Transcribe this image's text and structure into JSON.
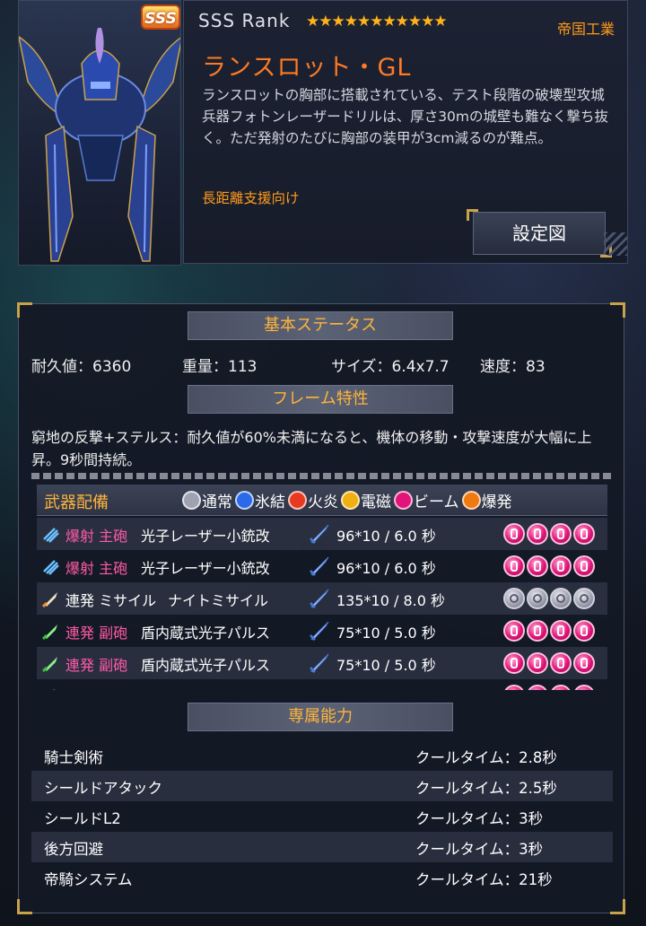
{
  "header": {
    "rarity_badge": "SSS",
    "rank_label": "SSS  Rank",
    "stars": "★★★★★★★★★★★",
    "manufacturer": "帝国工業",
    "mech_name": "ランスロット・GL",
    "description": "ランスロットの胸部に搭載されている、テスト段階の破壊型攻城兵器フォトンレーザードリルは、厚さ30mの城壁も難なく撃ち抜く。ただ発射のたびに胸部の装甲が3cm減るのが難点。",
    "role": "長距離支援向け",
    "setting_button": "設定図"
  },
  "basic_status": {
    "title": "基本ステータス",
    "durability": "耐久値：6360",
    "weight": "重量：113",
    "size": "サイズ：6.4x7.7",
    "speed": "速度：83"
  },
  "frame": {
    "title": "フレーム特性",
    "text": "窮地の反撃+ステルス：耐久値が60%未満になると、機体の移動・攻撃速度が大幅に上昇。9秒間持続。"
  },
  "weapons": {
    "title": "武器配備",
    "legend": [
      {
        "label": "通常",
        "icon": "normal-icon",
        "color": "#b8bac8"
      },
      {
        "label": "氷結",
        "icon": "ice-icon",
        "color": "#2a6ae8"
      },
      {
        "label": "火炎",
        "icon": "fire-icon",
        "color": "#e83a20"
      },
      {
        "label": "電磁",
        "icon": "electric-icon",
        "color": "#f0b010"
      },
      {
        "label": "ビーム",
        "icon": "beam-icon",
        "color": "#e2147a"
      },
      {
        "label": "爆発",
        "icon": "explosion-icon",
        "color": "#f07a10"
      }
    ],
    "rows": [
      {
        "mode": "爆射",
        "slot": "主砲",
        "name": "光子レーザー小銃改",
        "damage": "96*10 / 6.0 秒",
        "element": "beam",
        "pink": true
      },
      {
        "mode": "爆射",
        "slot": "主砲",
        "name": "光子レーザー小銃改",
        "damage": "96*10 / 6.0 秒",
        "element": "beam",
        "pink": true
      },
      {
        "mode": "連発",
        "slot": "ミサイル",
        "name": "ナイトミサイル",
        "damage": "135*10 / 8.0 秒",
        "element": "normal",
        "pink": false
      },
      {
        "mode": "連発",
        "slot": "副砲",
        "name": "盾内蔵式光子パルス",
        "damage": "75*10 / 5.0 秒",
        "element": "beam",
        "pink": true
      },
      {
        "mode": "連発",
        "slot": "副砲",
        "name": "盾内蔵式光子パルス",
        "damage": "75*10 / 5.0 秒",
        "element": "beam",
        "pink": true
      }
    ]
  },
  "abilities": {
    "title": "専属能力",
    "rows": [
      {
        "name": "騎士剣術",
        "cooldown": "クールタイム：2.8秒"
      },
      {
        "name": "シールドアタック",
        "cooldown": "クールタイム：2.5秒"
      },
      {
        "name": "シールドL2",
        "cooldown": "クールタイム：3秒"
      },
      {
        "name": "後方回避",
        "cooldown": "クールタイム：3秒"
      },
      {
        "name": "帝騎システム",
        "cooldown": "クールタイム：21秒"
      }
    ]
  }
}
